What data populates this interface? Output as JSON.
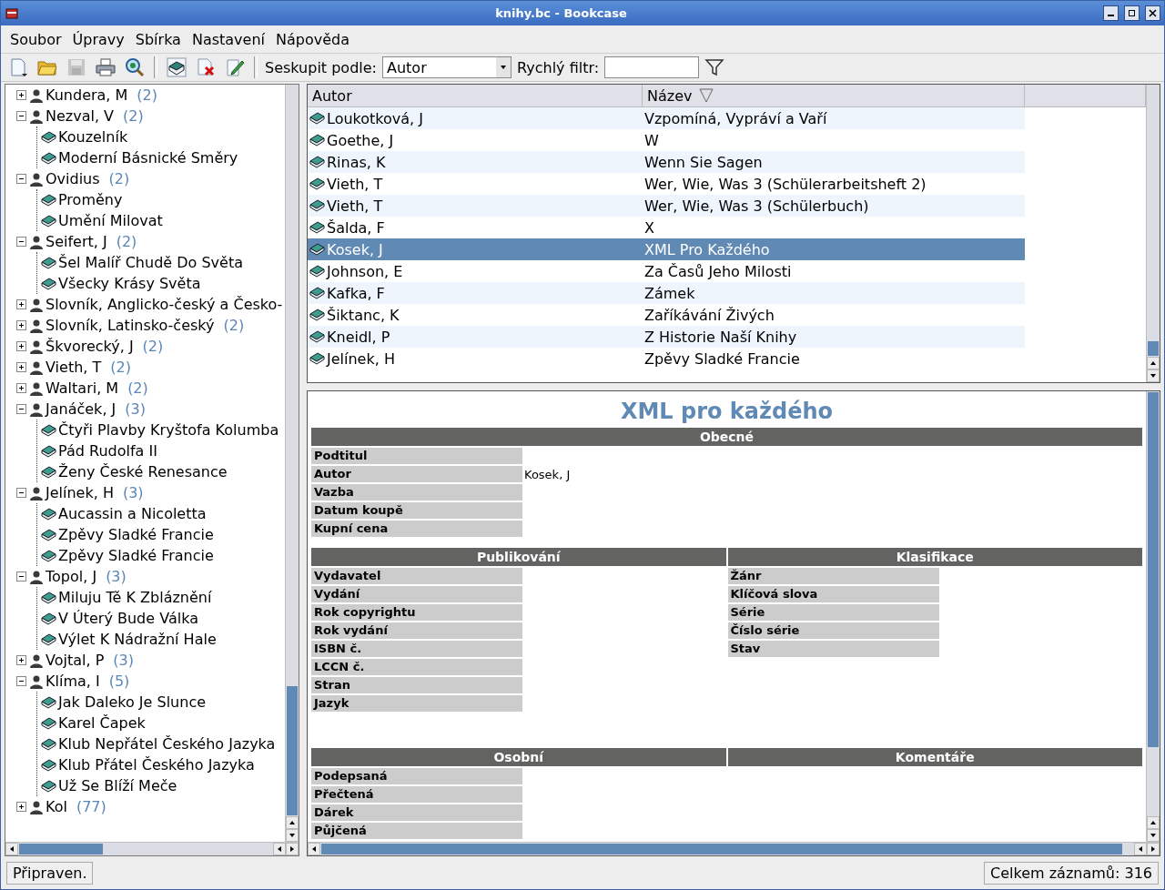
{
  "window": {
    "title": "knihy.bc - Bookcase"
  },
  "menu": [
    "Soubor",
    "Úpravy",
    "Sbírka",
    "Nastavení",
    "Nápověda"
  ],
  "toolbar": {
    "groups": [
      [
        {
          "kind": "new",
          "disabled": false
        },
        {
          "kind": "open",
          "disabled": false
        },
        {
          "kind": "save",
          "disabled": true
        },
        {
          "kind": "print",
          "disabled": false
        },
        {
          "kind": "find",
          "disabled": false
        }
      ],
      [
        {
          "kind": "add",
          "disabled": false
        },
        {
          "kind": "delete",
          "disabled": false
        },
        {
          "kind": "edit",
          "disabled": false
        }
      ]
    ],
    "group_by_label": "Seskupit podle:",
    "group_by_value": "Autor",
    "filter_label": "Rychlý filtr:"
  },
  "tree": [
    {
      "label": "Kundera, M",
      "count": "(2)",
      "expanded": false
    },
    {
      "label": "Nezval, V",
      "count": "(2)",
      "expanded": true,
      "children": [
        {
          "label": "Kouzelník"
        },
        {
          "label": "Moderní Básnické Směry"
        }
      ]
    },
    {
      "label": "Ovidius",
      "count": "(2)",
      "expanded": true,
      "children": [
        {
          "label": "Proměny"
        },
        {
          "label": "Umění Milovat"
        }
      ]
    },
    {
      "label": "Seifert, J",
      "count": "(2)",
      "expanded": true,
      "children": [
        {
          "label": "Šel Malíř Chudě Do Světa"
        },
        {
          "label": "Všecky Krásy Světa"
        }
      ]
    },
    {
      "label": "Slovník, Anglicko-český a Česko-",
      "expanded": false
    },
    {
      "label": "Slovník, Latinsko-český",
      "count": "(2)",
      "expanded": false
    },
    {
      "label": "Škvorecký, J",
      "count": "(2)",
      "expanded": false
    },
    {
      "label": "Vieth, T",
      "count": "(2)",
      "expanded": false
    },
    {
      "label": "Waltari, M",
      "count": "(2)",
      "expanded": false
    },
    {
      "label": "Janáček, J",
      "count": "(3)",
      "expanded": true,
      "children": [
        {
          "label": "Čtyři Plavby Kryštofa Kolumba"
        },
        {
          "label": "Pád Rudolfa II"
        },
        {
          "label": "Ženy České Renesance"
        }
      ]
    },
    {
      "label": "Jelínek, H",
      "count": "(3)",
      "expanded": true,
      "children": [
        {
          "label": "Aucassin a Nicoletta"
        },
        {
          "label": "Zpěvy Sladké Francie"
        },
        {
          "label": "Zpěvy Sladké Francie"
        }
      ]
    },
    {
      "label": "Topol, J",
      "count": "(3)",
      "expanded": true,
      "children": [
        {
          "label": "Miluju Tě K Zbláznění"
        },
        {
          "label": "V Úterý Bude Válka"
        },
        {
          "label": "Výlet K Nádražní Hale"
        }
      ]
    },
    {
      "label": "Vojtal, P",
      "count": "(3)",
      "expanded": false
    },
    {
      "label": "Klíma, I",
      "count": "(5)",
      "expanded": true,
      "children": [
        {
          "label": "Jak Daleko Je Slunce"
        },
        {
          "label": "Karel Čapek"
        },
        {
          "label": "Klub Nepřátel Českého Jazyka"
        },
        {
          "label": "Klub Přátel Českého Jazyka"
        },
        {
          "label": "Už Se Blíží Meče"
        }
      ]
    },
    {
      "label": "Kol",
      "count": "(77)",
      "expanded": false
    }
  ],
  "table": {
    "columns": [
      {
        "label": "Autor",
        "sorted": false
      },
      {
        "label": "Název",
        "sorted": true
      }
    ],
    "rows": [
      {
        "author": "Loukotková, J",
        "title": "Vzpomíná, Vypráví a Vaří",
        "selected": false
      },
      {
        "author": "Goethe, J",
        "title": "W",
        "selected": false
      },
      {
        "author": "Rinas, K",
        "title": "Wenn Sie Sagen",
        "selected": false
      },
      {
        "author": "Vieth, T",
        "title": "Wer, Wie, Was 3 (Schülerarbeitsheft 2)",
        "selected": false
      },
      {
        "author": "Vieth, T",
        "title": "Wer, Wie, Was 3 (Schülerbuch)",
        "selected": false
      },
      {
        "author": "Šalda, F",
        "title": "X",
        "selected": false
      },
      {
        "author": "Kosek, J",
        "title": "XML Pro Každého",
        "selected": true
      },
      {
        "author": "Johnson, E",
        "title": "Za Časů Jeho Milosti",
        "selected": false
      },
      {
        "author": "Kafka, F",
        "title": "Zámek",
        "selected": false
      },
      {
        "author": "Šiktanc, K",
        "title": "Zaříkávání Živých",
        "selected": false
      },
      {
        "author": "Kneidl, P",
        "title": "Z Historie Naší Knihy",
        "selected": false
      },
      {
        "author": "Jelínek, H",
        "title": "Zpěvy Sladké Francie",
        "selected": false
      }
    ]
  },
  "details": {
    "title": "XML pro každého",
    "rows": [
      [
        {
          "heading": "Obecné",
          "fields": [
            {
              "label": "Podtitul"
            },
            {
              "label": "Autor",
              "value": "Kosek, J"
            },
            {
              "label": "Vazba"
            },
            {
              "label": "Datum koupě"
            },
            {
              "label": "Kupní cena"
            }
          ]
        }
      ],
      [
        {
          "heading": "Publikování",
          "fields": [
            {
              "label": "Vydavatel"
            },
            {
              "label": "Vydání"
            },
            {
              "label": "Rok copyrightu"
            },
            {
              "label": "Rok vydání"
            },
            {
              "label": "ISBN č."
            },
            {
              "label": "LCCN č."
            },
            {
              "label": "Stran"
            },
            {
              "label": "Jazyk"
            }
          ]
        },
        {
          "heading": "Klasifikace",
          "fields": [
            {
              "label": "Žánr"
            },
            {
              "label": "Klíčová slova"
            },
            {
              "label": "Série"
            },
            {
              "label": "Číslo série"
            },
            {
              "label": "Stav"
            }
          ]
        }
      ],
      [
        {
          "heading": "Osobní",
          "fields": [
            {
              "label": "Podepsaná"
            },
            {
              "label": "Přečtená"
            },
            {
              "label": "Dárek"
            },
            {
              "label": "Půjčená"
            }
          ]
        },
        {
          "heading": "Komentáře"
        }
      ]
    ]
  },
  "status_bar": {
    "message": "Připraven.",
    "count": "Celkem záznamů: 316"
  }
}
